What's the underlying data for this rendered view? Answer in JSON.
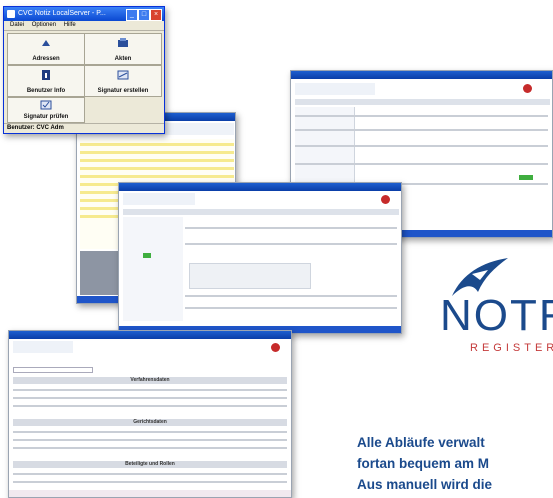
{
  "window": {
    "title": "CVC Notiz LocalServer - P...",
    "menu": [
      "Datei",
      "Optionen",
      "Hilfe"
    ],
    "buttons": [
      {
        "label": "Adressen",
        "icon": "address-icon"
      },
      {
        "label": "Akten",
        "icon": "folder-icon"
      },
      {
        "label": "Benutzer Info",
        "icon": "user-info-icon"
      },
      {
        "label": "Signatur erstellen",
        "icon": "signature-create-icon"
      },
      {
        "label": "Signatur prüfen",
        "icon": "signature-check-icon"
      }
    ],
    "status": "Benutzer: CVC Adm"
  },
  "doc": {
    "sections": [
      "Verfahrensdaten",
      "Gerichtsdaten",
      "Beteiligte und Rollen"
    ]
  },
  "logo": {
    "wordmark": "NOTR",
    "sub": "REGISTER"
  },
  "tagline": [
    "Alle Abläufe verwalt",
    "fortan bequem am M",
    "Aus manuell wird die"
  ],
  "colors": {
    "brand_blue": "#1b4a8c",
    "brand_red": "#c43a3a",
    "titlebar": "#0a48d1"
  }
}
